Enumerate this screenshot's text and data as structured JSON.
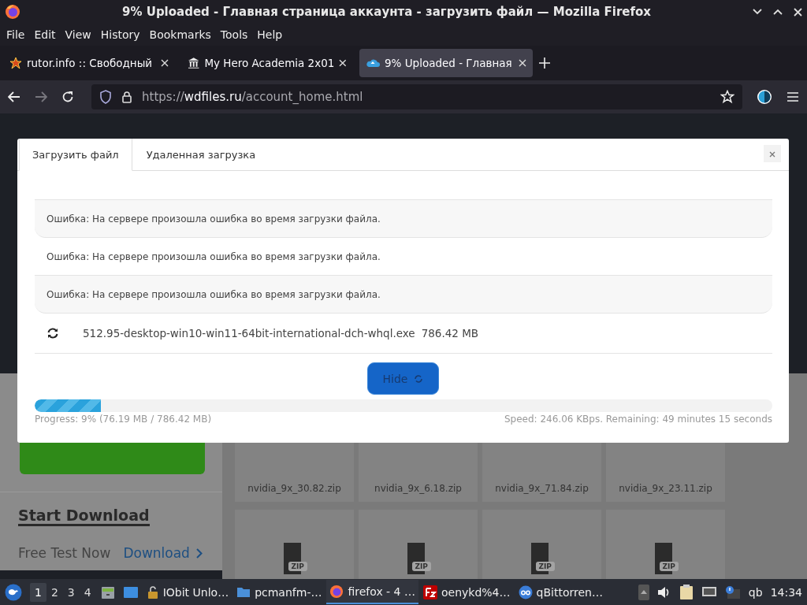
{
  "window": {
    "title": "9% Uploaded - Главная страница аккаунта - загрузить файл — Mozilla Firefox"
  },
  "menu": [
    {
      "label": "File"
    },
    {
      "label": "Edit"
    },
    {
      "label": "View"
    },
    {
      "label": "History"
    },
    {
      "label": "Bookmarks"
    },
    {
      "label": "Tools"
    },
    {
      "label": "Help"
    }
  ],
  "tabs": [
    {
      "label": "rutor.info :: Свободный",
      "selected": false
    },
    {
      "label": "My Hero Academia 2x01",
      "selected": false
    },
    {
      "label": "9% Uploaded - Главная",
      "selected": true
    }
  ],
  "address": {
    "url": "https://**wdfiles.ru**/account_home.html"
  },
  "page": {
    "sidebar": {
      "heading": "Start Download",
      "text": "Free Test Now",
      "link": "Download"
    },
    "files": [
      {
        "name": "nvidia_9x_30.82.zip",
        "kind": "named"
      },
      {
        "name": "nvidia_9x_6.18.zip",
        "kind": "named"
      },
      {
        "name": "nvidia_9x_71.84.zip",
        "kind": "named"
      },
      {
        "name": "nvidia_9x_23.11.zip",
        "kind": "named"
      },
      {
        "badge": "ZIP",
        "kind": "archive"
      },
      {
        "badge": "ZIP",
        "kind": "archive"
      },
      {
        "badge": "ZIP",
        "kind": "archive"
      },
      {
        "badge": "ZIP",
        "kind": "archive"
      }
    ]
  },
  "modal": {
    "tabs": [
      {
        "label": "Загрузить файл",
        "selected": true
      },
      {
        "label": "Удаленная загрузка",
        "selected": false
      }
    ],
    "messages": [
      {
        "kind": "error",
        "text": "Ошибка: На сервере произошла ошибка во время загрузки файла."
      },
      {
        "kind": "error",
        "text": "Ошибка: На сервере произошла ошибка во время загрузки файла."
      },
      {
        "kind": "error",
        "text": "Ошибка: На сервере произошла ошибка во время загрузки файла."
      },
      {
        "kind": "uploading",
        "name": "512.95-desktop-win10-win11-64bit-international-dch-whql.exe",
        "size": "786.42 MB"
      }
    ],
    "hide_button": {
      "label": "Hide"
    },
    "progress": {
      "level": 0.09,
      "label": "Progress: 9% (76.19 MB / 786.42 MB)",
      "speed": "Speed: 246.06 KBps. Remaining: 49 minutes 15 seconds"
    }
  },
  "taskbar": {
    "workspaces": [
      {
        "label": "1",
        "selected": true
      },
      {
        "label": "2",
        "selected": false
      },
      {
        "label": "3",
        "selected": false
      },
      {
        "label": "4",
        "selected": false
      }
    ],
    "tasks": [
      {
        "label": "IObit Unlo…",
        "selected": false
      },
      {
        "label": "pcmanfm-…",
        "selected": false
      },
      {
        "label": "firefox - 4 …",
        "selected": true
      },
      {
        "label": "oenykd%4…",
        "selected": false
      },
      {
        "label": "qBittorren…",
        "selected": false
      }
    ],
    "tray_label": "qb",
    "clock": "14:34"
  }
}
